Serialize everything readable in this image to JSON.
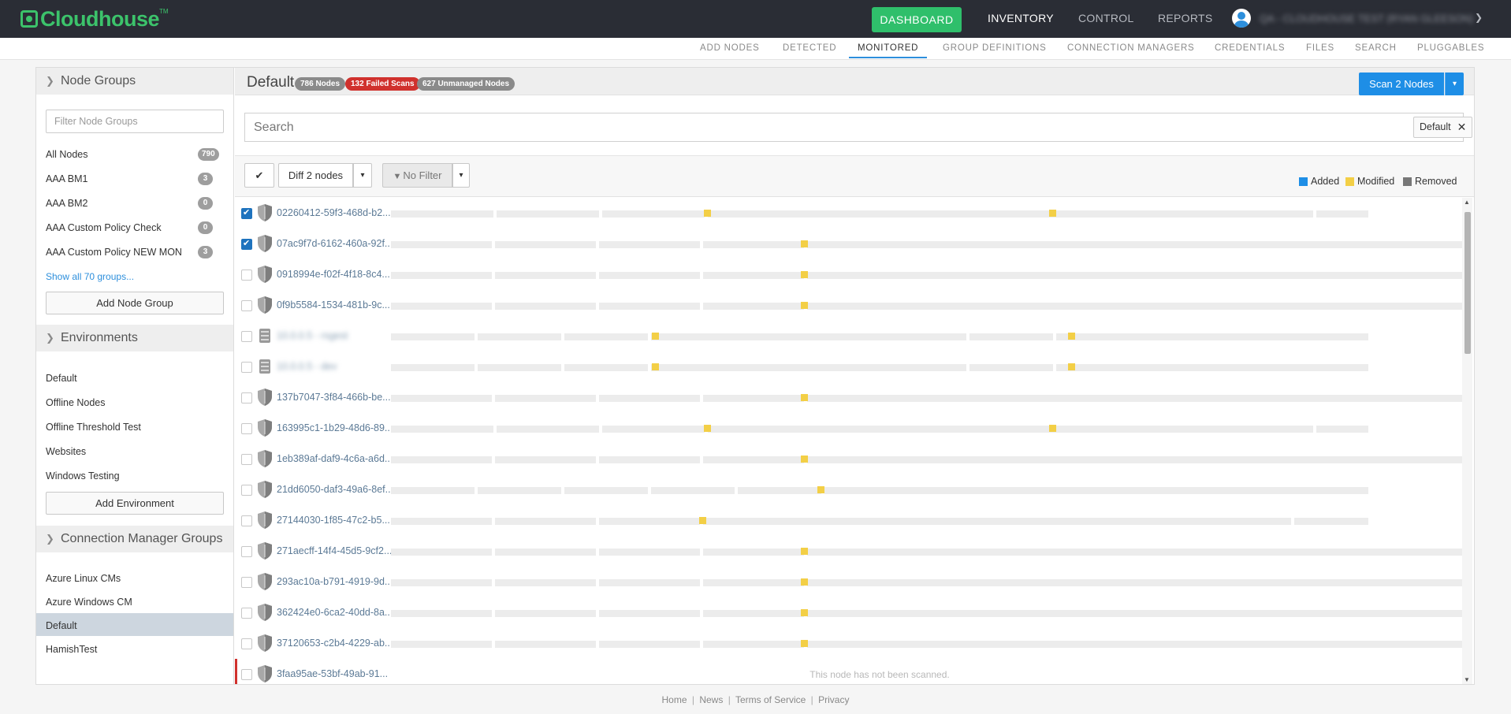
{
  "brand": {
    "name": "Cloudhouse",
    "tm": "TM"
  },
  "topnav": {
    "dashboard": "DASHBOARD",
    "inventory": "INVENTORY",
    "control": "CONTROL",
    "reports": "REPORTS",
    "user_name": "QA - CLOUDHOUSE TEST (RYAN GLEESON)"
  },
  "subnav": [
    "ADD NODES",
    "DETECTED",
    "MONITORED",
    "GROUP DEFINITIONS",
    "CONNECTION MANAGERS",
    "CREDENTIALS",
    "FILES",
    "SEARCH",
    "PLUGGABLES"
  ],
  "sidebar": {
    "node_groups": {
      "title": "Node Groups",
      "filter_placeholder": "Filter Node Groups",
      "items": [
        {
          "label": "All Nodes",
          "count": "790"
        },
        {
          "label": "AAA BM1",
          "count": "3"
        },
        {
          "label": "AAA BM2",
          "count": "0"
        },
        {
          "label": "AAA Custom Policy Check",
          "count": "0"
        },
        {
          "label": "AAA Custom Policy NEW MON",
          "count": "3"
        }
      ],
      "show_all": "Show all 70 groups...",
      "add_button": "Add Node Group"
    },
    "environments": {
      "title": "Environments",
      "items": [
        "Default",
        "Offline Nodes",
        "Offline Threshold Test",
        "Websites",
        "Windows Testing"
      ],
      "add_button": "Add Environment"
    },
    "cm_groups": {
      "title": "Connection Manager Groups",
      "items": [
        "Azure Linux CMs",
        "Azure Windows CM",
        "Default",
        "HamishTest"
      ]
    }
  },
  "content": {
    "title": "Default",
    "badges": {
      "nodes": "786 Nodes",
      "failed": "132 Failed Scans",
      "unmanaged": "627 Unmanaged Nodes"
    },
    "scan_button": "Scan 2 Nodes",
    "search": {
      "placeholder": "Search",
      "tag": "Default",
      "tag_close": "✕"
    },
    "toolbar": {
      "check_icon": "✔",
      "diff_label": "Diff 2 nodes",
      "filter_label": "No Filter",
      "caret": "▾"
    },
    "legend": {
      "added": "Added",
      "modified": "Modified",
      "removed": "Removed"
    },
    "colors": {
      "added": "#1e8ee6",
      "modified": "#f3cf46",
      "removed": "#777777",
      "failed": "#d0312d"
    },
    "rows": [
      {
        "name": "02260412-59f3-468d-b2...",
        "checked": true
      },
      {
        "name": "07ac9f7d-6162-460a-92f...",
        "checked": true
      },
      {
        "name": "0918994e-f02f-4f18-8c4...",
        "checked": false
      },
      {
        "name": "0f9b5584-1534-481b-9c...",
        "checked": false
      },
      {
        "name": "10.0.0.5 - rsgest",
        "checked": false,
        "blurred": true
      },
      {
        "name": "10.0.0.5 - dev",
        "checked": false,
        "blurred": true
      },
      {
        "name": "137b7047-3f84-466b-be...",
        "checked": false
      },
      {
        "name": "163995c1-1b29-48d6-89...",
        "checked": false
      },
      {
        "name": "1eb389af-daf9-4c6a-a6d...",
        "checked": false
      },
      {
        "name": "21dd6050-daf3-49a6-8ef...",
        "checked": false
      },
      {
        "name": "27144030-1f85-47c2-b5...",
        "checked": false
      },
      {
        "name": "271aecff-14f4-45d5-9cf2...",
        "checked": false
      },
      {
        "name": "293ac10a-b791-4919-9d...",
        "checked": false
      },
      {
        "name": "362424e0-6ca2-40dd-8a...",
        "checked": false
      },
      {
        "name": "37120653-c2b4-4229-ab...",
        "checked": false
      },
      {
        "name": "3faa95ae-53bf-49ab-91...",
        "checked": false,
        "failed": true,
        "message": "This node has not been scanned."
      }
    ]
  },
  "footer": {
    "home": "Home",
    "news": "News",
    "terms": "Terms of Service",
    "privacy": "Privacy",
    "sep": "|"
  }
}
